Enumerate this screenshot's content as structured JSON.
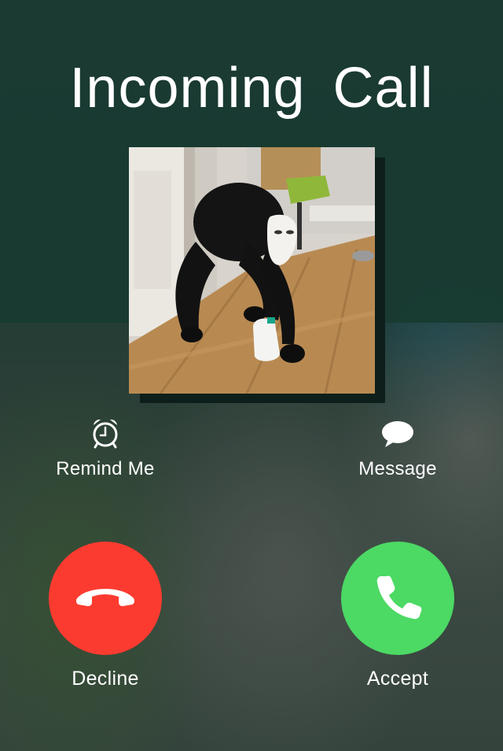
{
  "header": {
    "title": "Incoming  Call"
  },
  "caller": {
    "photo": "caller-photo"
  },
  "actions": {
    "remind": {
      "label": "Remind Me",
      "icon": "alarm-clock-icon"
    },
    "message": {
      "label": "Message",
      "icon": "speech-bubble-icon"
    }
  },
  "buttons": {
    "decline": {
      "label": "Decline",
      "icon": "phone-hangup-icon",
      "color": "#fb3b30"
    },
    "accept": {
      "label": "Accept",
      "icon": "phone-icon",
      "color": "#4cd964"
    }
  }
}
